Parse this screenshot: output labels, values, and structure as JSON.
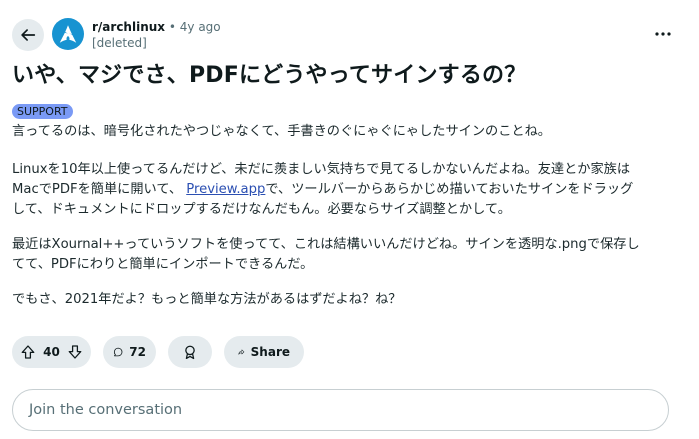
{
  "post": {
    "subreddit": "r/archlinux",
    "separator": "•",
    "age": "4y ago",
    "author": "[deleted]",
    "title": "いや、マジでさ、PDFにどうやってサインするの？",
    "flair": "SUPPORT",
    "body": {
      "p1": "言ってるのは、暗号化されたやつじゃなくて、手書きのぐにゃぐにゃしたサインのことね。",
      "p2_l1": "Linuxを10年以上使ってるんだけど、未だに羨ましい気持ちで見てるしかないんだよね。友達とか家族は",
      "p2_l2_pre": "MacでPDFを簡単に開いて、 ",
      "p2_link": "Preview.app",
      "p2_l2_post": "で、ツールバーからあらかじめ描いておいたサインをドラッグ",
      "p2_l3": "して、ドキュメントにドロップするだけなんだもん。必要ならサイズ調整とかして。",
      "p3_l1": "最近はXournal++っていうソフトを使ってて、これは結構いいんだけどね。サインを透明な.pngで保存し",
      "p3_l2": "てて、PDFにわりと簡単にインポートできるんだ。",
      "p4": "でもさ、2021年だよ？もっと簡単な方法があるはずだよね？ね？"
    }
  },
  "actions": {
    "votes": "40",
    "comments": "72",
    "share_label": "Share"
  },
  "comment_input": {
    "placeholder": "Join the conversation"
  },
  "icons": {
    "back": "arrow-left-icon",
    "more": "ellipsis-icon",
    "upvote": "upvote-arrow-icon",
    "downvote": "downvote-arrow-icon",
    "comments": "speech-bubble-icon",
    "award": "award-icon",
    "share": "share-arrow-icon",
    "avatar": "arch-linux-logo"
  },
  "colors": {
    "pill_bg": "#e5ebee",
    "flair_bg": "#7a9af5",
    "link": "#2b4fb2",
    "arch_blue": "#1793d1"
  }
}
